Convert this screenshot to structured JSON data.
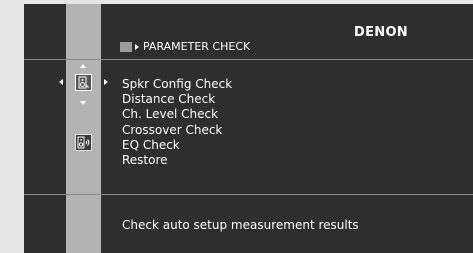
{
  "header": {
    "brand": "DENON",
    "breadcrumb": "PARAMETER CHECK"
  },
  "menu": {
    "items": [
      {
        "label": "Spkr Config Check"
      },
      {
        "label": "Distance Check"
      },
      {
        "label": "Ch. Level Check"
      },
      {
        "label": "Crossover Check"
      },
      {
        "label": "EQ Check"
      },
      {
        "label": "Restore"
      }
    ]
  },
  "footer": {
    "guide_text": "Check auto setup measurement results"
  },
  "icons": {
    "selected": "speaker-config-icon",
    "second": "speaker-sound-icon",
    "nav": [
      "nav-up-icon",
      "nav-down-icon",
      "nav-left-icon",
      "nav-right-icon"
    ]
  },
  "colors": {
    "screen_bg": "#2e2e2e",
    "sidebar": "#b3b3b3",
    "text": "#ffffff",
    "divider": "#8a8a8a",
    "page_bg": "#e5e5e5"
  }
}
